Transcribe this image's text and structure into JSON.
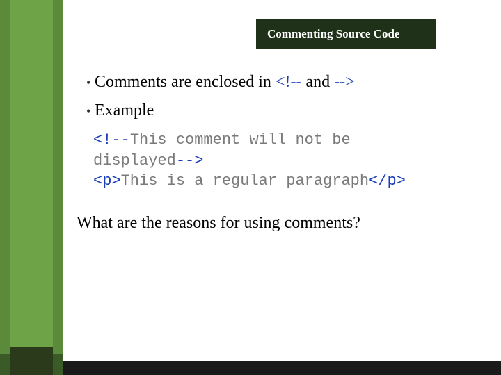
{
  "title": "Commenting Source Code",
  "bullets": {
    "line1_prefix": "Comments are enclosed in ",
    "line1_tag_open": "<!--",
    "line1_and": " and ",
    "line1_tag_close": "-->",
    "line2": "Example"
  },
  "code": {
    "l1a": "<!--",
    "l1b": "This comment will not be",
    "l2a": "displayed",
    "l2b": "-->",
    "l3a": "<p>",
    "l3b": "This is a regular paragraph",
    "l3c": "</p>"
  },
  "question": "What are the reasons for using comments?",
  "bullet_char": "•"
}
